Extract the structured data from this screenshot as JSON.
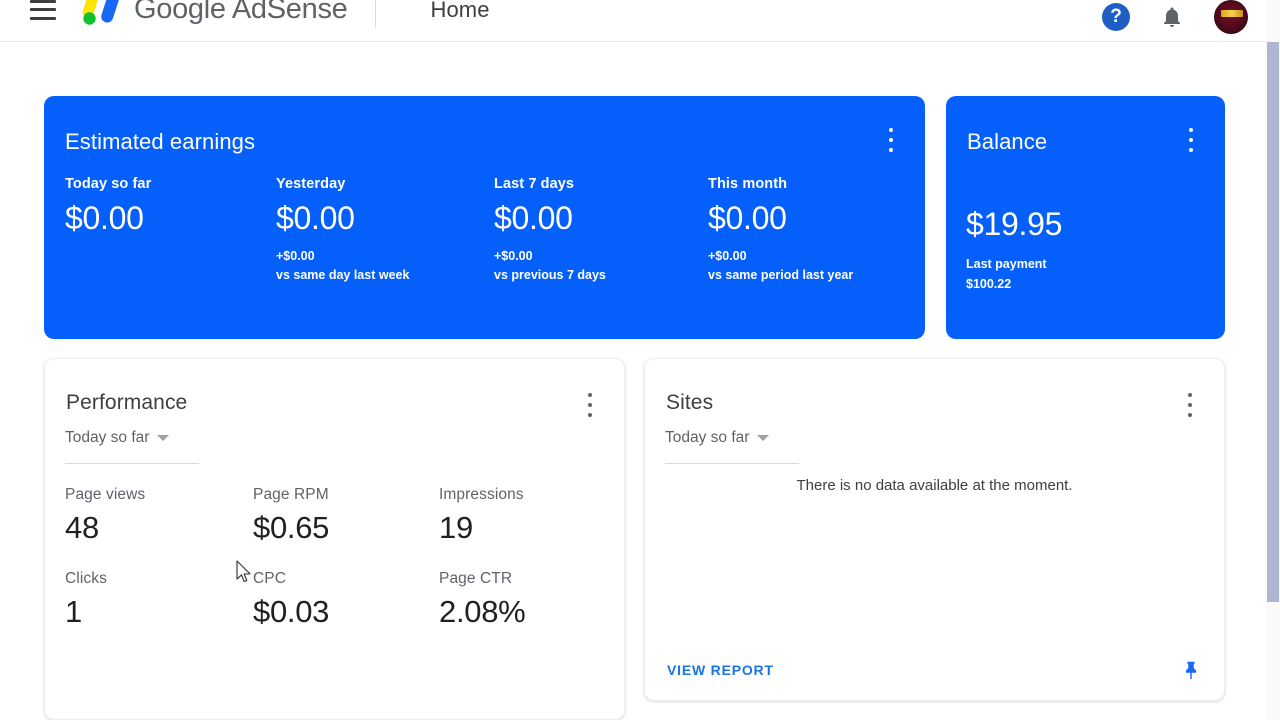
{
  "header": {
    "menu_icon": "hamburger-menu-icon",
    "brand": "Google AdSense",
    "logo_icon": "adsense-logo-icon",
    "nav_home": "Home",
    "help_icon": "?",
    "help_icon_name": "help-icon",
    "bell_icon_name": "notifications-bell-icon",
    "avatar_name": "account-avatar"
  },
  "colors": {
    "brand_blue": "#0560fb",
    "link_blue": "#1a73e8",
    "text_primary": "#202124",
    "text_secondary": "#5f6368",
    "scrollbar_thumb": "#aeb6d3"
  },
  "earnings": {
    "title": "Estimated earnings",
    "metrics": [
      {
        "label": "Today so far",
        "value": "$0.00",
        "delta": "",
        "comparison": ""
      },
      {
        "label": "Yesterday",
        "value": "$0.00",
        "delta": "+$0.00",
        "comparison": "vs same day last week"
      },
      {
        "label": "Last 7 days",
        "value": "$0.00",
        "delta": "+$0.00",
        "comparison": "vs previous 7 days"
      },
      {
        "label": "This month",
        "value": "$0.00",
        "delta": "+$0.00",
        "comparison": "vs same period last year"
      }
    ]
  },
  "balance": {
    "title": "Balance",
    "value": "$19.95",
    "last_payment_label": "Last payment",
    "last_payment_value": "$100.22"
  },
  "performance": {
    "title": "Performance",
    "range": "Today so far",
    "metrics": [
      {
        "label": "Page views",
        "value": "48"
      },
      {
        "label": "Page RPM",
        "value": "$0.65"
      },
      {
        "label": "Impressions",
        "value": "19"
      },
      {
        "label": "Clicks",
        "value": "1"
      },
      {
        "label": "CPC",
        "value": "$0.03"
      },
      {
        "label": "Page CTR",
        "value": "2.08%"
      }
    ]
  },
  "sites": {
    "title": "Sites",
    "range": "Today so far",
    "empty_message": "There is no data available at the moment.",
    "view_report": "VIEW REPORT",
    "pin_icon_name": "pin-icon"
  }
}
